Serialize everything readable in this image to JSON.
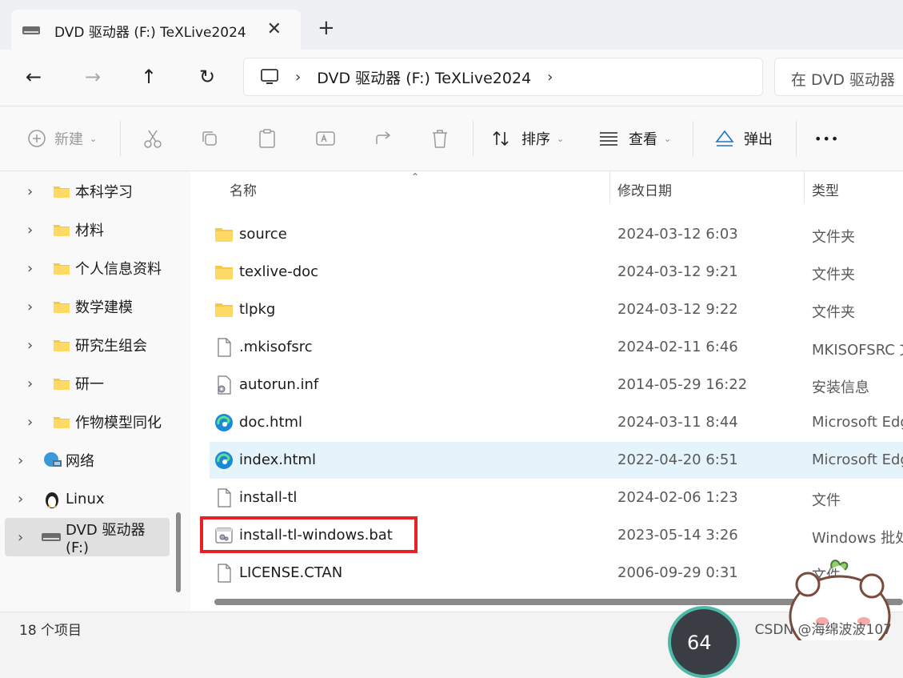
{
  "tab": {
    "title": "DVD 驱动器 (F:) TeXLive2024",
    "close": "✕",
    "new": "+"
  },
  "nav": {
    "back": "←",
    "forward": "→",
    "up": "↑",
    "refresh": "↻"
  },
  "address": {
    "separator": "›",
    "path": "DVD 驱动器 (F:) TeXLive2024",
    "trailing": "›"
  },
  "search": {
    "placeholder": "在 DVD 驱动器"
  },
  "toolbar": {
    "new_label": "新建",
    "sort_label": "排序",
    "view_label": "查看",
    "eject_label": "弹出",
    "more_label": "•••"
  },
  "sidebar": {
    "items": [
      {
        "label": "本科学习",
        "icon": "folder-icon"
      },
      {
        "label": "材料",
        "icon": "folder-icon"
      },
      {
        "label": "个人信息资料",
        "icon": "folder-icon"
      },
      {
        "label": "数学建模",
        "icon": "folder-icon"
      },
      {
        "label": "研究生组会",
        "icon": "folder-icon"
      },
      {
        "label": "研一",
        "icon": "folder-icon"
      },
      {
        "label": "作物模型同化",
        "icon": "folder-icon"
      },
      {
        "label": "网络",
        "icon": "network-icon"
      },
      {
        "label": "Linux",
        "icon": "linux-icon"
      },
      {
        "label": "DVD 驱动器 (F:)",
        "icon": "drive-icon"
      }
    ]
  },
  "columns": {
    "name": "名称",
    "date": "修改日期",
    "type": "类型"
  },
  "files": [
    {
      "name": "source",
      "date": "2024-03-12 6:03",
      "type": "文件夹",
      "icon": "folder-icon"
    },
    {
      "name": "texlive-doc",
      "date": "2024-03-12 9:21",
      "type": "文件夹",
      "icon": "folder-icon"
    },
    {
      "name": "tlpkg",
      "date": "2024-03-12 9:22",
      "type": "文件夹",
      "icon": "folder-icon"
    },
    {
      "name": ".mkisofsrc",
      "date": "2024-02-11 6:46",
      "type": "MKISOFSRC 文",
      "icon": "file-icon"
    },
    {
      "name": "autorun.inf",
      "date": "2014-05-29 16:22",
      "type": "安装信息",
      "icon": "settings-file-icon"
    },
    {
      "name": "doc.html",
      "date": "2024-03-11 8:44",
      "type": "Microsoft Edg",
      "icon": "edge-icon"
    },
    {
      "name": "index.html",
      "date": "2022-04-20 6:51",
      "type": "Microsoft Edg",
      "icon": "edge-icon"
    },
    {
      "name": "install-tl",
      "date": "2024-02-06 1:23",
      "type": "文件",
      "icon": "file-icon"
    },
    {
      "name": "install-tl-windows.bat",
      "date": "2023-05-14 3:26",
      "type": "Windows 批处",
      "icon": "batch-file-icon"
    },
    {
      "name": "LICENSE.CTAN",
      "date": "2006-09-29 0:31",
      "type": "文件",
      "icon": "file-icon"
    }
  ],
  "status": {
    "count": "18 个项目",
    "watermark": "CSDN @海绵波波107",
    "gauge": "64"
  },
  "colors": {
    "highlight": "#e82127",
    "hover_row": "#e5f3fb",
    "folder": "#f7c948",
    "edge": "#1a8ad8"
  }
}
